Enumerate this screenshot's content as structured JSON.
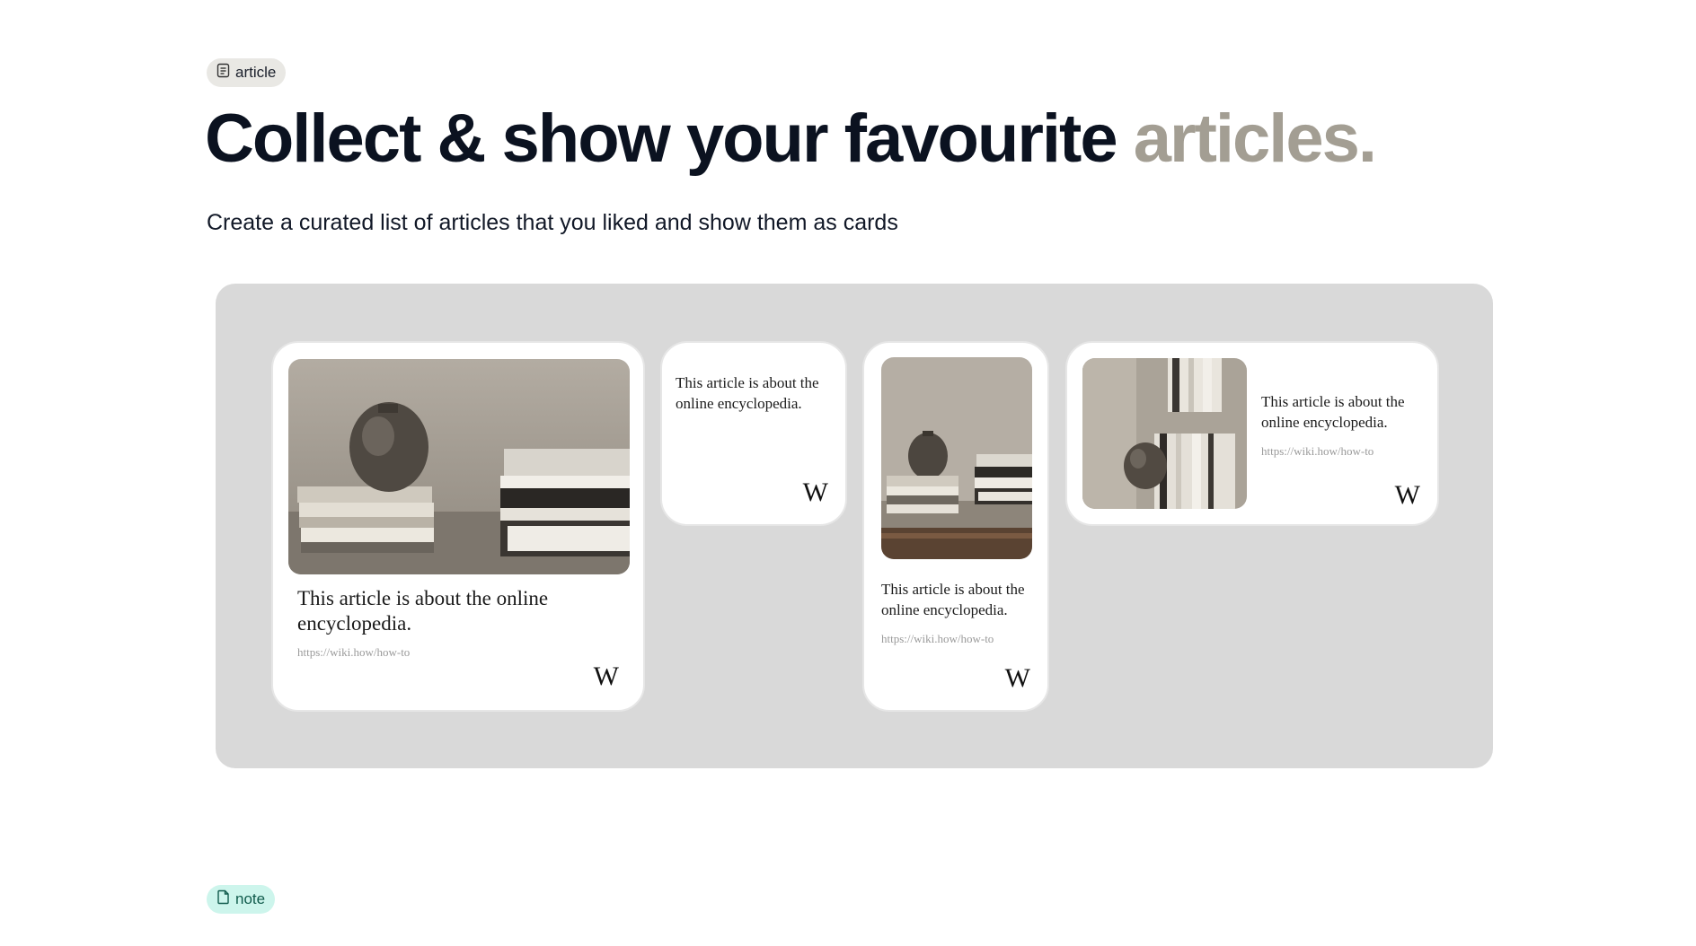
{
  "section_article": {
    "tag_label": "article",
    "headline_main": "Collect & show your favourite ",
    "headline_accent": "articles.",
    "subtitle": "Create a curated list of articles that you liked and show them as cards"
  },
  "cards": [
    {
      "title": "This article is about the online encyclopedia.",
      "url": "https://wiki.how/how-to",
      "logo": "W"
    },
    {
      "title": "This article is about the online encyclopedia.",
      "logo": "W"
    },
    {
      "title": "This article is about the online encyclopedia.",
      "url": "https://wiki.how/how-to",
      "logo": "W"
    },
    {
      "title": "This article is about the online encyclopedia.",
      "url": "https://wiki.how/how-to",
      "logo": "W"
    }
  ],
  "section_note": {
    "tag_label": "note"
  },
  "icons": {
    "article_tag_icon": "document-lines-icon",
    "note_tag_icon": "document-icon",
    "card_logo_icon": "wikipedia-w-icon"
  },
  "colors": {
    "accent_gray": "#a39e93",
    "board_bg": "#d9d9d9",
    "article_tag_bg": "#e9e8e4",
    "note_tag_bg": "#cdf5ec"
  }
}
